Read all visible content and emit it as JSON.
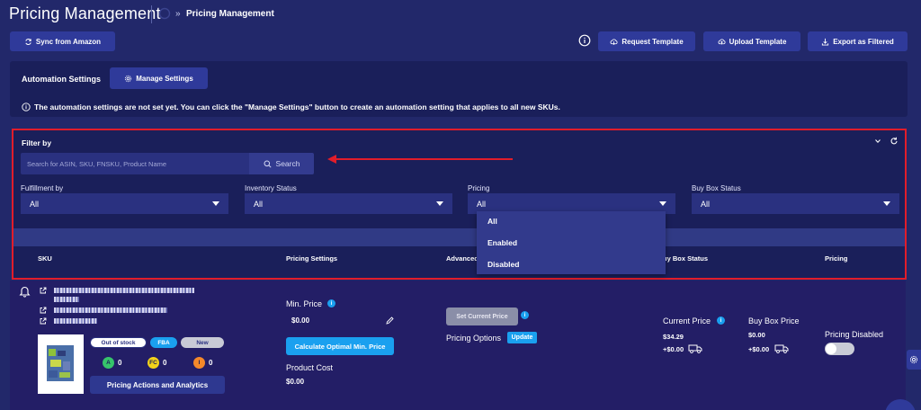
{
  "header": {
    "title": "Pricing Management",
    "breadcrumb_sep": "»",
    "breadcrumb_current": "Pricing Management"
  },
  "toolbar": {
    "sync_label": "Sync from Amazon",
    "request_template_label": "Request Template",
    "upload_template_label": "Upload Template",
    "export_label": "Export as Filtered"
  },
  "automation": {
    "label": "Automation Settings",
    "manage_label": "Manage Settings",
    "note": "The automation settings are not set yet. You can click the \"Manage Settings\" button to create an automation setting that applies to all new SKUs."
  },
  "filter": {
    "title": "Filter by",
    "search_placeholder": "Search for ASIN, SKU, FNSKU, Product Name",
    "search_button": "Search",
    "fields": [
      {
        "label": "Fulfillment by",
        "value": "All"
      },
      {
        "label": "Inventory Status",
        "value": "All"
      },
      {
        "label": "Pricing",
        "value": "All"
      },
      {
        "label": "Buy Box Status",
        "value": "All"
      }
    ],
    "pricing_options": [
      "All",
      "Enabled",
      "Disabled"
    ]
  },
  "table": {
    "headers": {
      "sku": "SKU",
      "pricing_settings": "Pricing Settings",
      "advanced": "Advanced",
      "buy_box_status": "uy Box Status",
      "pricing": "Pricing"
    }
  },
  "row": {
    "badges": {
      "stock": "Out of stock",
      "fulfillment": "FBA",
      "condition": "New"
    },
    "circles": [
      {
        "letter": "A",
        "value": "0",
        "color": "#36c46b"
      },
      {
        "letter": "FC",
        "value": "0",
        "color": "#f2d21a"
      },
      {
        "letter": "I",
        "value": "0",
        "color": "#f5892a"
      }
    ],
    "pricing_actions": "Pricing Actions and Analytics",
    "min_price_label": "Min. Price",
    "min_price_value": "$0.00",
    "calc_button": "Calculate Optimal Min. Price",
    "product_cost_label": "Product Cost",
    "product_cost_value": "$0.00",
    "set_current_price": "Set Current Price",
    "pricing_options_label": "Pricing Options",
    "update_label": "Update",
    "current_price_label": "Current Price",
    "current_price_value": "$34.29",
    "current_shipping": "+$0.00",
    "buy_box_price_label": "Buy Box Price",
    "buy_box_price_value": "$0.00",
    "buy_box_shipping": "+$0.00",
    "pricing_status": "Pricing Disabled"
  },
  "colors": {
    "background": "#22286a",
    "panel": "#1a1f5a",
    "accent": "#1aa0ef",
    "highlight_border": "#e11d2a"
  }
}
